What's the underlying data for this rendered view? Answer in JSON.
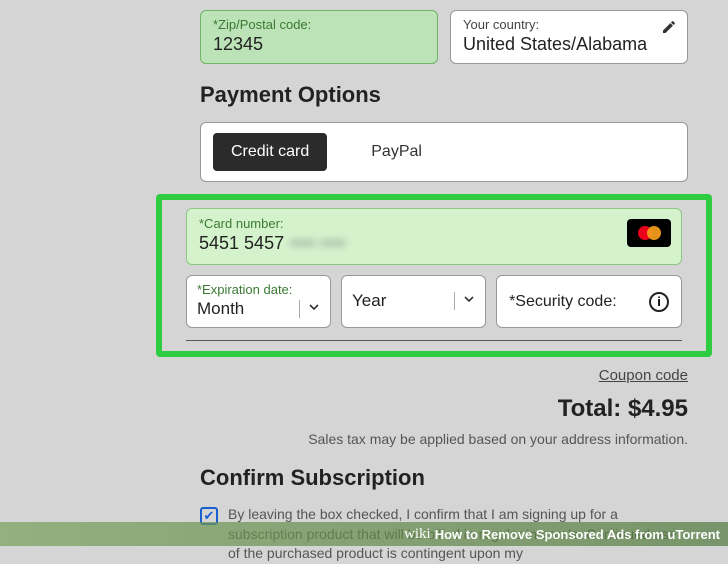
{
  "address": {
    "zip_label": "*Zip/Postal code:",
    "zip_value": "12345",
    "country_label": "Your country:",
    "country_value": "United States/Alabama"
  },
  "payment": {
    "heading": "Payment Options",
    "tabs": {
      "credit": "Credit card",
      "paypal": "PayPal"
    },
    "card_number_label": "*Card number:",
    "card_number_visible": "5451 5457",
    "card_number_hidden": "•••• ••••",
    "card_brand": "mastercard",
    "exp_label": "*Expiration date:",
    "exp_month": "Month",
    "exp_year": "Year",
    "sec_label": "*Security code:"
  },
  "summary": {
    "coupon": "Coupon code",
    "total_label": "Total:",
    "total_value": "$4.95",
    "tax_note": "Sales tax may be applied based on your address information."
  },
  "confirm": {
    "heading": "Confirm Subscription",
    "text": "By leaving the box checked, I confirm that I am signing up for a subscription product that will be billed in regular intervals. Continued use of the purchased product is contingent upon my"
  },
  "caption": {
    "brand": "wiki",
    "title": "How to Remove Sponsored Ads from uTorrent"
  }
}
